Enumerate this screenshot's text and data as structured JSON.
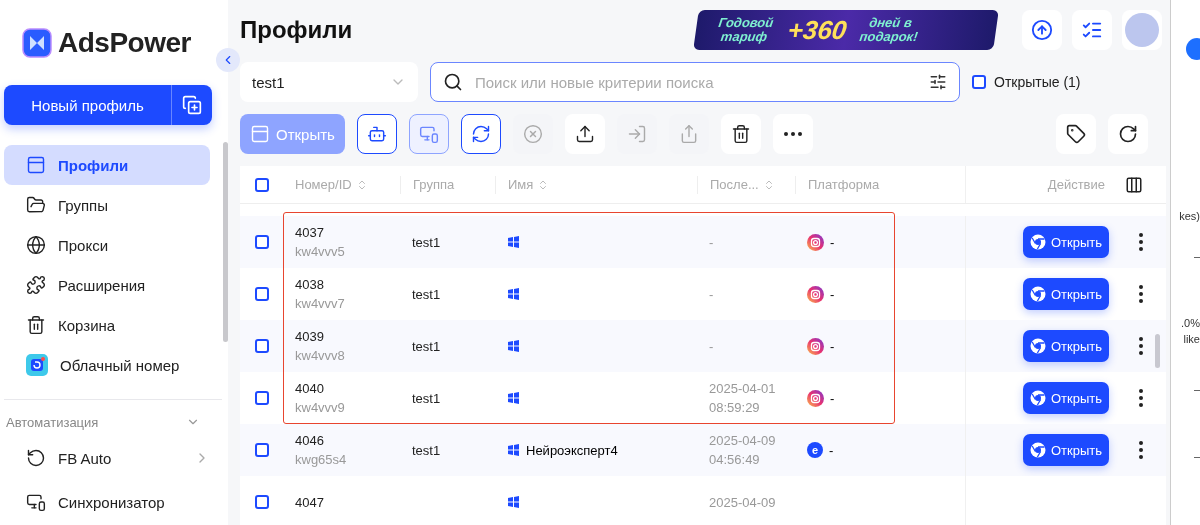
{
  "sidebar": {
    "brand": "AdsPower",
    "new_profile": "Новый профиль",
    "items": [
      {
        "kind": "window",
        "label": "Профили",
        "selected": true
      },
      {
        "kind": "folder",
        "label": "Группы",
        "selected": false
      },
      {
        "kind": "globe",
        "label": "Прокси",
        "selected": false
      },
      {
        "kind": "puzzle",
        "label": "Расширения",
        "selected": false
      },
      {
        "kind": "trash",
        "label": "Корзина",
        "selected": false
      },
      {
        "kind": "cloud",
        "label": "Облачный номер",
        "selected": false
      }
    ],
    "section": {
      "title": "Автоматизация",
      "expanded": true,
      "items": [
        {
          "kind": "fb",
          "label": "FB Auto",
          "has_submenu": true
        },
        {
          "kind": "screens",
          "label": "Синхронизатор",
          "has_submenu": false
        }
      ]
    }
  },
  "header": {
    "title": "Профили",
    "promo": {
      "left": "Годовой тариф",
      "number": "+360",
      "right": "дней в подарок!"
    }
  },
  "filters": {
    "group": "test1",
    "search_placeholder": "Поиск или новые критерии поиска",
    "opened_filter": {
      "label": "Открытые (1)",
      "checked": false
    }
  },
  "toolbar": [
    {
      "kind": "open",
      "label": "Открыть",
      "outlined": false,
      "disabled": true
    },
    {
      "kind": "robot",
      "outlined": true,
      "disabled": false
    },
    {
      "kind": "screens",
      "outlined": true,
      "disabled": true
    },
    {
      "kind": "fb",
      "outlined": true,
      "disabled": false
    },
    {
      "kind": "close",
      "outlined": false,
      "disabled": true
    },
    {
      "kind": "upload",
      "outlined": false,
      "disabled": false
    },
    {
      "kind": "import",
      "outlined": false,
      "disabled": true
    },
    {
      "kind": "share",
      "outlined": false,
      "disabled": true
    },
    {
      "kind": "trash",
      "outlined": false,
      "disabled": false
    },
    {
      "kind": "more",
      "outlined": false,
      "disabled": false
    }
  ],
  "table": {
    "columns": [
      "Номер/ID",
      "Группа",
      "Имя",
      "После...",
      "Платформа",
      "Действие"
    ],
    "rows": [
      {
        "checked": false,
        "highlighted": true,
        "number": "4037",
        "serial": "kw4vvv5",
        "group": "test1",
        "name": "",
        "last_date": "-",
        "last_time": "",
        "platform": {
          "kind": "instagram",
          "text": "-"
        },
        "action": "Открыть"
      },
      {
        "checked": false,
        "highlighted": true,
        "number": "4038",
        "serial": "kw4vvv7",
        "group": "test1",
        "name": "",
        "last_date": "-",
        "last_time": "",
        "platform": {
          "kind": "instagram",
          "text": "-"
        },
        "action": "Открыть"
      },
      {
        "checked": false,
        "highlighted": true,
        "number": "4039",
        "serial": "kw4vvv8",
        "group": "test1",
        "name": "",
        "last_date": "-",
        "last_time": "",
        "platform": {
          "kind": "instagram",
          "text": "-"
        },
        "action": "Открыть"
      },
      {
        "checked": false,
        "highlighted": true,
        "number": "4040",
        "serial": "kw4vvv9",
        "group": "test1",
        "name": "",
        "last_date": "2025-04-01",
        "last_time": "08:59:29",
        "platform": {
          "kind": "instagram",
          "text": "-"
        },
        "action": "Открыть"
      },
      {
        "checked": false,
        "highlighted": false,
        "number": "4046",
        "serial": "kwg65s4",
        "group": "test1",
        "name": "Нейроэксперт4",
        "last_date": "2025-04-09",
        "last_time": "04:56:49",
        "platform": {
          "kind": "letter",
          "letter": "e",
          "text": "-"
        },
        "action": "Открыть"
      },
      {
        "checked": false,
        "highlighted": false,
        "number": "4047",
        "serial": "",
        "group": "",
        "name": "",
        "last_date": "2025-04-09",
        "last_time": "",
        "action": ""
      }
    ],
    "all_checked": false
  },
  "side_window": {
    "texts": [
      "kes)",
      "–",
      ".0%",
      "like",
      "–",
      "–"
    ]
  }
}
